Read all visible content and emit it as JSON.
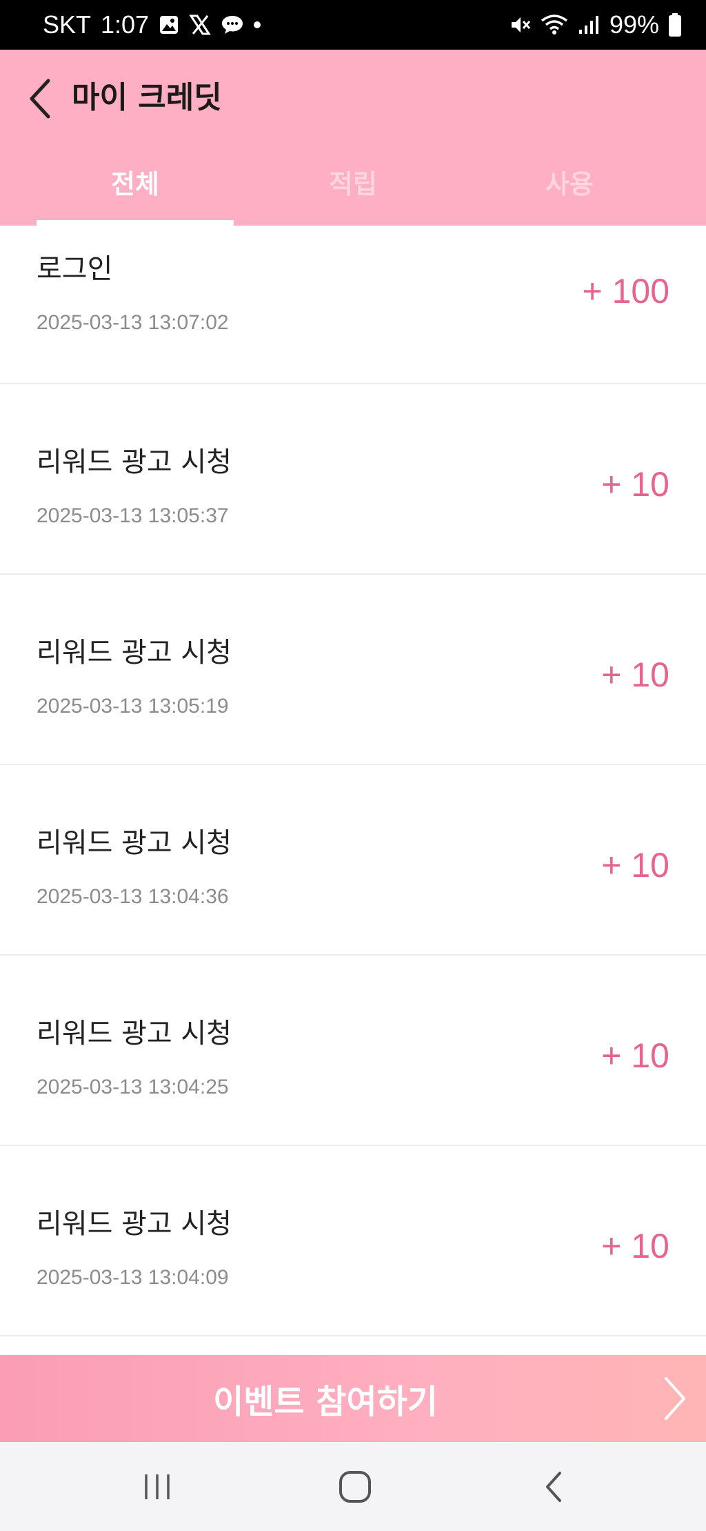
{
  "status_bar": {
    "carrier": "SKT",
    "time": "1:07",
    "battery": "99%",
    "notification_icons": [
      "gallery-icon",
      "x-logo-icon",
      "chat-bubble-icon",
      "dot-icon"
    ],
    "system_icons": [
      "mute-icon",
      "wifi-icon",
      "signal-icon",
      "battery-icon"
    ]
  },
  "header": {
    "title": "마이 크레딧",
    "back_icon": "chevron-left-icon",
    "tabs": [
      {
        "label": "전체",
        "active": true
      },
      {
        "label": "적립",
        "active": false
      },
      {
        "label": "사용",
        "active": false
      }
    ]
  },
  "transactions": [
    {
      "title": "로그인",
      "date": "2025-03-13 13:07:02",
      "amount": "+ 100"
    },
    {
      "title": "리워드 광고 시청",
      "date": "2025-03-13 13:05:37",
      "amount": "+ 10"
    },
    {
      "title": "리워드 광고 시청",
      "date": "2025-03-13 13:05:19",
      "amount": "+ 10"
    },
    {
      "title": "리워드 광고 시청",
      "date": "2025-03-13 13:04:36",
      "amount": "+ 10"
    },
    {
      "title": "리워드 광고 시청",
      "date": "2025-03-13 13:04:25",
      "amount": "+ 10"
    },
    {
      "title": "리워드 광고 시청",
      "date": "2025-03-13 13:04:09",
      "amount": "+ 10"
    }
  ],
  "event_banner": {
    "label": "이벤트 참여하기",
    "arrow_icon": "chevron-right-icon"
  },
  "nav_bar": {
    "buttons": [
      "recent-apps-icon",
      "home-icon",
      "back-icon"
    ]
  },
  "colors": {
    "header_bg": "#ffafc3",
    "accent_amount": "#e8648f",
    "tab_active": "#ffffff",
    "tab_inactive": "#ffd6e0"
  }
}
